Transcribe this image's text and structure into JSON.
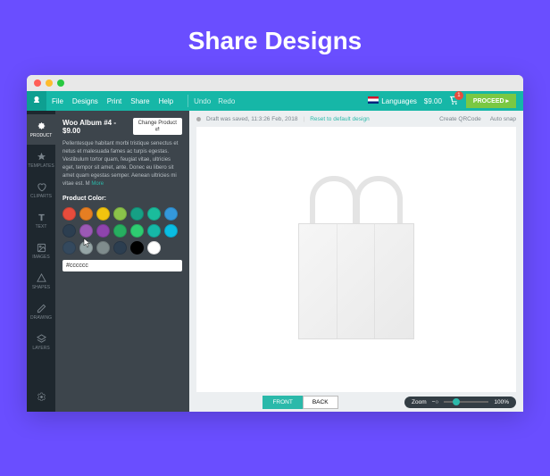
{
  "hero": {
    "title": "Share Designs"
  },
  "menubar": {
    "items": [
      "File",
      "Designs",
      "Print",
      "Share",
      "Help"
    ],
    "undo": "Undo",
    "redo": "Redo",
    "languages": "Languages",
    "price": "$9.00",
    "cart_count": "1",
    "proceed": "PROCEED ▸"
  },
  "iconbar": {
    "tools": [
      {
        "label": "PRODUCT"
      },
      {
        "label": "TEMPLATES"
      },
      {
        "label": "CLIPARTS"
      },
      {
        "label": "TEXT"
      },
      {
        "label": "IMAGES"
      },
      {
        "label": "SHAPES"
      },
      {
        "label": "DRAWING"
      },
      {
        "label": "LAYERS"
      }
    ]
  },
  "panel": {
    "product_title": "Woo Album #4 - $9.00",
    "change_btn": "Change Product ⇄",
    "lorem": "Pellentesque habitant morbi tristique senectus et netus et malesuada fames ac turpis egestas. Vestibulum tortor quam, feugiat vitae, ultricies eget, tempor sit amet, ante. Donec eu libero sit amet quam egestas semper. Aenean ultricies mi vitae est. M",
    "more": "More",
    "color_label": "Product Color:",
    "swatches": [
      "#e74c3c",
      "#e67e22",
      "#f1c40f",
      "#8bc34a",
      "#16a085",
      "#1abc9c",
      "#3498db",
      "#2c3e50",
      "#9b59b6",
      "#8e44ad",
      "#27ae60",
      "#2ecc71",
      "#16b7a7",
      "#0abde3",
      "#34495e",
      "#95a5a6",
      "#7f8c8d",
      "#2c3e50",
      "#000000",
      "#ffffff"
    ],
    "hex_value": "#cccccc"
  },
  "canvas": {
    "status": "Draft was saved, 11:3:26 Feb, 2018",
    "reset": "Reset to default design",
    "create_qr": "Create QRCode",
    "autosnap": "Auto snap"
  },
  "footer": {
    "front": "FRONT",
    "back": "BACK",
    "zoom_label": "Zoom",
    "zoom_value": "100%"
  }
}
